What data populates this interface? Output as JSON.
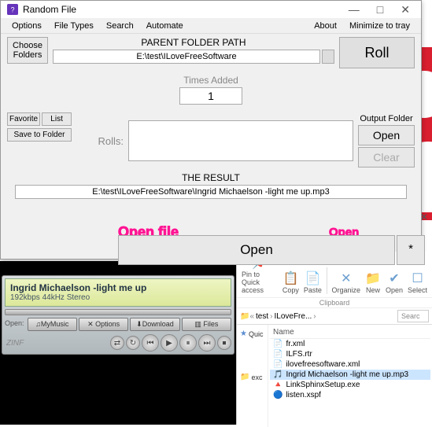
{
  "window": {
    "title": "Random File",
    "menu": {
      "options": "Options",
      "filetypes": "File Types",
      "search": "Search",
      "automate": "Automate",
      "about": "About",
      "minimize": "Minimize to tray"
    },
    "controls": {
      "min": "—",
      "max": "□",
      "close": "✕"
    }
  },
  "main": {
    "choose_folders": "Choose Folders",
    "parent_label": "PARENT FOLDER PATH",
    "parent_path": "E:\\test\\ILoveFreeSoftware",
    "roll": "Roll",
    "times_label": "Times Added",
    "times_value": "1",
    "rolls_label": "Rolls:",
    "output_folder_lbl": "Output Folder",
    "open_btn": "Open",
    "clear_btn": "Clear",
    "favorite": "Favorite",
    "list": "List",
    "save_folder": "Save to Folder",
    "result_label": "THE RESULT",
    "result_path": "E:\\test\\ILoveFreeSoftware\\Ingrid Michaelson -light me up.mp3",
    "open_result": "Open",
    "star": "*"
  },
  "annot": {
    "open_file": "Open file",
    "open_folder": "Open containing folder"
  },
  "player": {
    "track": "Ingrid Michaelson -light me up",
    "info": "192kbps 44kHz Stereo",
    "open": "Open:",
    "mymusic": "♫MyMusic",
    "options": "✕ Options",
    "download": "⬇Download",
    "files": "▥ Files",
    "brand": "ZINF"
  },
  "explorer": {
    "tools": {
      "pin": "Pin to Quick access",
      "copy": "Copy",
      "paste": "Paste",
      "organize": "Organize",
      "new": "New",
      "open": "Open",
      "select": "Select"
    },
    "section": "Clipboard",
    "bc": {
      "test": "test",
      "ilfs": "ILoveFre..."
    },
    "search_ph": "Searc",
    "sidebar": {
      "quick": "Quic",
      "exc": "exc"
    },
    "col_name": "Name",
    "files": [
      {
        "icon": "📄",
        "name": "fr.xml",
        "sel": false
      },
      {
        "icon": "📄",
        "name": "ILFS.rtr",
        "sel": false
      },
      {
        "icon": "📄",
        "name": "ilovefreesoftware.xml",
        "sel": false
      },
      {
        "icon": "🎵",
        "name": "Ingrid Michaelson -light me up.mp3",
        "sel": true
      },
      {
        "icon": "🔺",
        "name": "LinkSphinxSetup.exe",
        "sel": false
      },
      {
        "icon": "🔵",
        "name": "listen.xspf",
        "sel": false
      }
    ]
  }
}
